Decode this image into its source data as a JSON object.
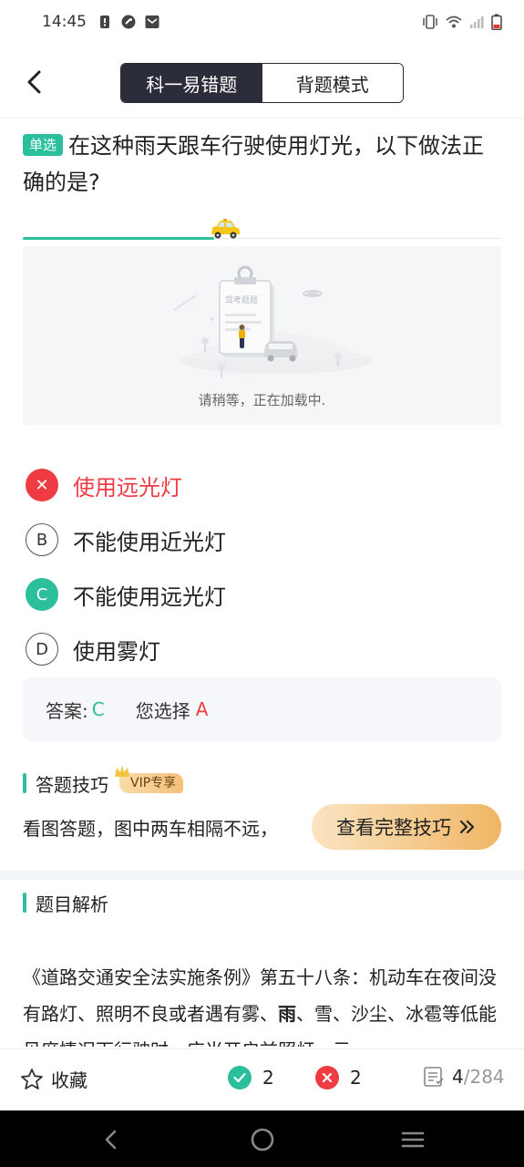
{
  "status_bar": {
    "time": "14:45",
    "left_icons": [
      "alert-icon",
      "settings-circle-icon",
      "mail-icon"
    ],
    "right_icons": [
      "vibrate-icon",
      "wifi-icon",
      "signal-icon",
      "battery-icon"
    ]
  },
  "nav": {
    "back_icon": "chevron-left-icon",
    "tabs": [
      {
        "label": "科一易错题",
        "active": true
      },
      {
        "label": "背题模式",
        "active": false
      }
    ]
  },
  "question": {
    "type_badge": "单选",
    "text": "在这种雨天跟车行驶使用灯光，以下做法正确的是?",
    "progress_fraction": 0.4
  },
  "image": {
    "loading_text": "请稍等，正在加载中.",
    "placeholder_label": "驾考题题"
  },
  "options": [
    {
      "mark": "✕",
      "text": "使用远光灯",
      "state": "wrong"
    },
    {
      "mark": "B",
      "text": "不能使用近光灯",
      "state": "plain"
    },
    {
      "mark": "C",
      "text": "不能使用远光灯",
      "state": "correct"
    },
    {
      "mark": "D",
      "text": "使用雾灯",
      "state": "plain"
    }
  ],
  "answer": {
    "label": "答案:",
    "correct": "C",
    "yours_label": "您选择",
    "yours": "A"
  },
  "tips": {
    "title": "答题技巧",
    "vip_badge": "VIP专享",
    "text": "看图答题，图中两车相隔不远，",
    "button_label": "查看完整技巧",
    "button_icon": "double-chevron-right-icon"
  },
  "analysis": {
    "title": "题目解析",
    "text_before": "《道路交通安全法实施条例》第五十八条：机动车在夜间没有路灯、照明不良或者遇有雾、",
    "text_bold": "雨",
    "text_after": "、雪、沙尘、冰雹等低能见度情况下行驶时，应当开启前照灯、示"
  },
  "bottom_bar": {
    "favorite_label": "收藏",
    "correct_count": "2",
    "wrong_count": "2",
    "current": "4",
    "total": "/284"
  },
  "colors": {
    "accent": "#2bbf9e",
    "error": "#ef3b43",
    "dark": "#2b2d3a",
    "vip_gold": "#efb664"
  }
}
